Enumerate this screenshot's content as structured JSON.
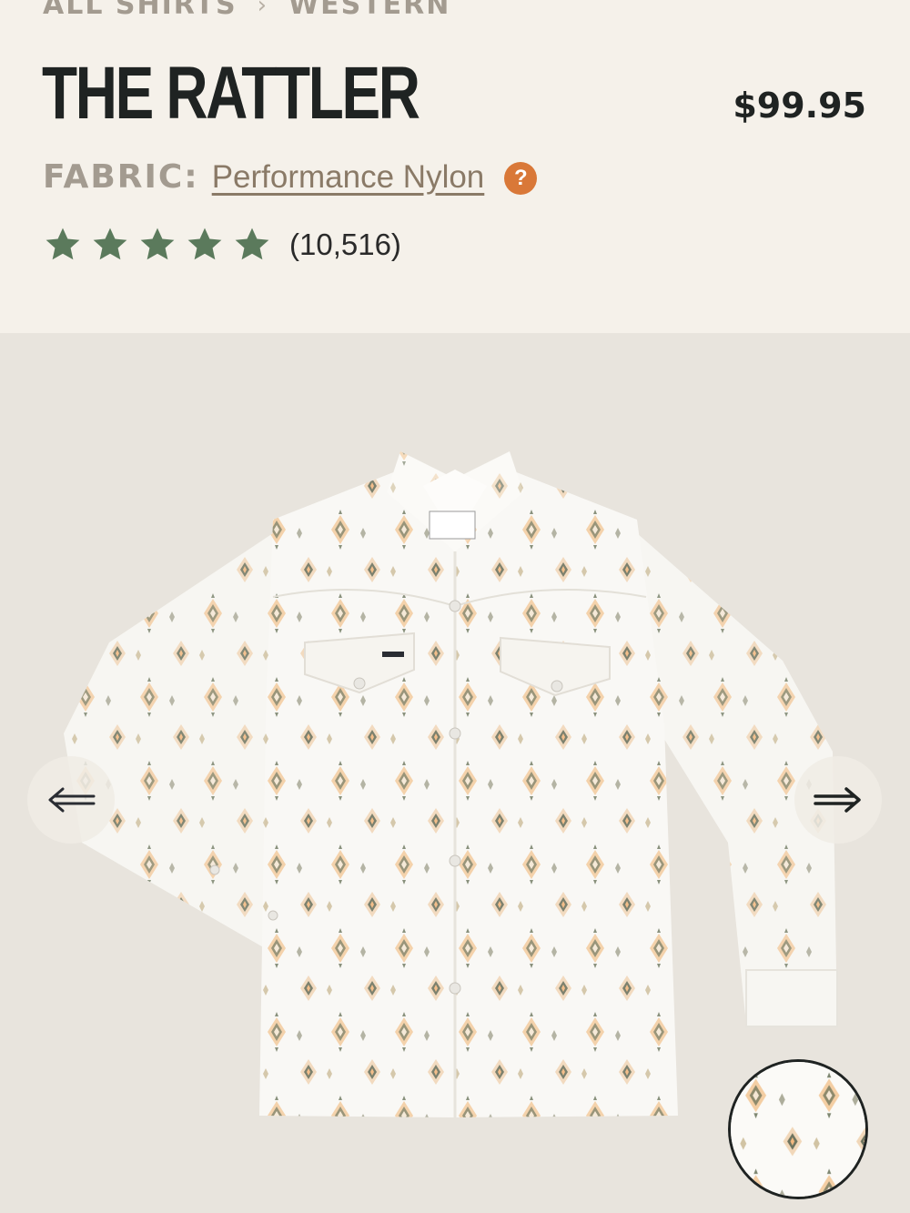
{
  "breadcrumb": {
    "items": [
      "ALL SHIRTS",
      "WESTERN"
    ],
    "separator": "›"
  },
  "product": {
    "title": "THE RATTLER",
    "price": "$99.95",
    "fabric_label": "FABRIC:",
    "fabric_value": "Performance Nylon",
    "help_icon": "?",
    "rating_value": 5,
    "rating_max": 5,
    "review_count": "(10,516)"
  },
  "gallery": {
    "prev_icon": "arrow-left-icon",
    "next_icon": "arrow-right-icon",
    "thumbnail_count": 1
  },
  "colors": {
    "background": "#f5f1ea",
    "gallery_bg": "#e8e4dd",
    "star": "#5b7a5c",
    "help_badge": "#d97838",
    "muted_text": "#a39b90",
    "title_text": "#1f2322"
  }
}
